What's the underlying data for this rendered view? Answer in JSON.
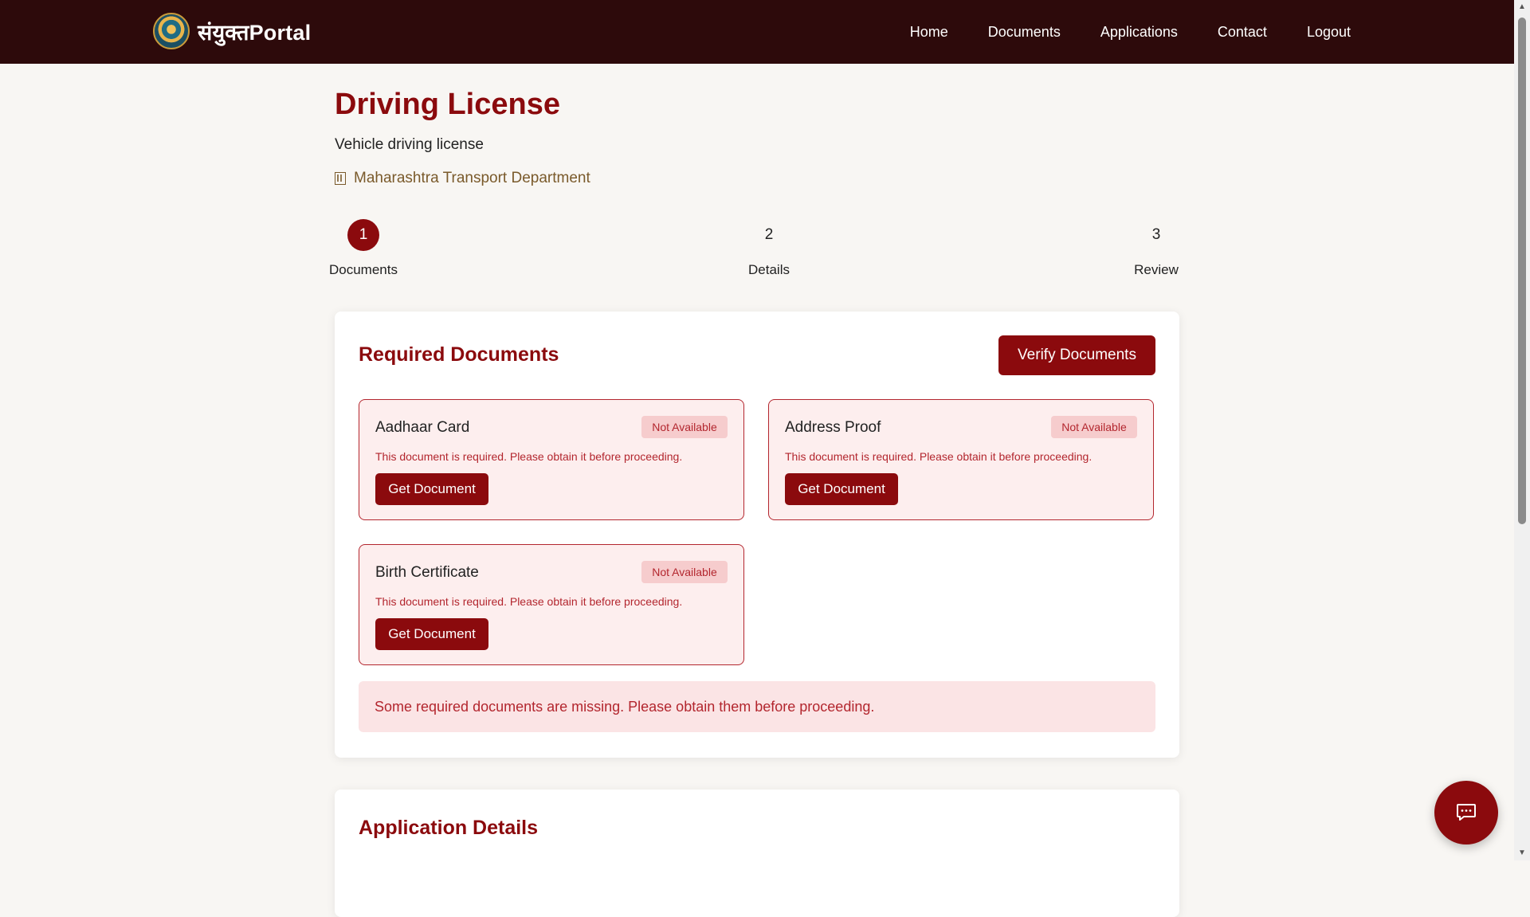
{
  "brand": {
    "name": "संयुक्तPortal",
    "emblem_icon": "state-emblem-icon"
  },
  "nav": {
    "items": [
      "Home",
      "Documents",
      "Applications",
      "Contact",
      "Logout"
    ]
  },
  "page": {
    "title": "Driving License",
    "subtitle": "Vehicle driving license",
    "department": "Maharashtra Transport Department",
    "department_icon": "building-icon"
  },
  "stepper": {
    "steps": [
      {
        "number": "1",
        "label": "Documents",
        "active": true
      },
      {
        "number": "2",
        "label": "Details",
        "active": false
      },
      {
        "number": "3",
        "label": "Review",
        "active": false
      }
    ]
  },
  "required_documents": {
    "title": "Required Documents",
    "verify_label": "Verify Documents",
    "docs": [
      {
        "name": "Aadhaar Card",
        "status": "Not Available",
        "note": "This document is required. Please obtain it before proceeding.",
        "action": "Get Document"
      },
      {
        "name": "Address Proof",
        "status": "Not Available",
        "note": "This document is required. Please obtain it before proceeding.",
        "action": "Get Document"
      },
      {
        "name": "Birth Certificate",
        "status": "Not Available",
        "note": "This document is required. Please obtain it before proceeding.",
        "action": "Get Document"
      }
    ],
    "alert": "Some required documents are missing. Please obtain them before proceeding."
  },
  "application_details": {
    "title": "Application Details"
  },
  "chat": {
    "icon": "chat-icon"
  },
  "colors": {
    "primary": "#8b0a0d",
    "navbar": "#2d0a0b",
    "danger_text": "#b3262e",
    "danger_bg": "#fdeeee",
    "department_text": "#7a5a2b"
  }
}
